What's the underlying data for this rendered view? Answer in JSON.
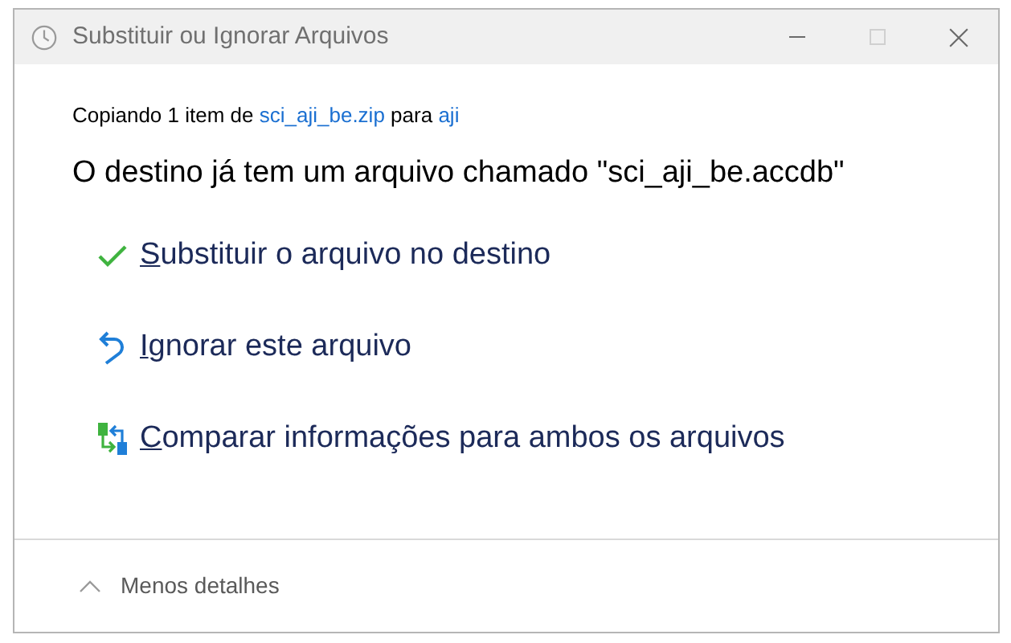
{
  "window": {
    "title": "Substituir ou Ignorar Arquivos",
    "controls": [
      {
        "kind": "minimize",
        "disabled": false
      },
      {
        "kind": "maximize",
        "disabled": true
      },
      {
        "kind": "close",
        "disabled": false
      }
    ]
  },
  "copy_line": {
    "prefix": "Copiando 1 item de",
    "source": "sci_aji_be.zip",
    "middle": "para",
    "destination": "aji"
  },
  "message": "O destino já tem um arquivo chamado \"sci_aji_be.accdb\"",
  "options": [
    {
      "kind": "replace",
      "label": "Substituir o arquivo no destino"
    },
    {
      "kind": "skip",
      "label": "Ignorar este arquivo"
    },
    {
      "kind": "compare",
      "label": "Comparar informações para ambos os arquivos"
    }
  ],
  "details_toggle": {
    "label": "Menos detalhes",
    "expanded": true
  }
}
